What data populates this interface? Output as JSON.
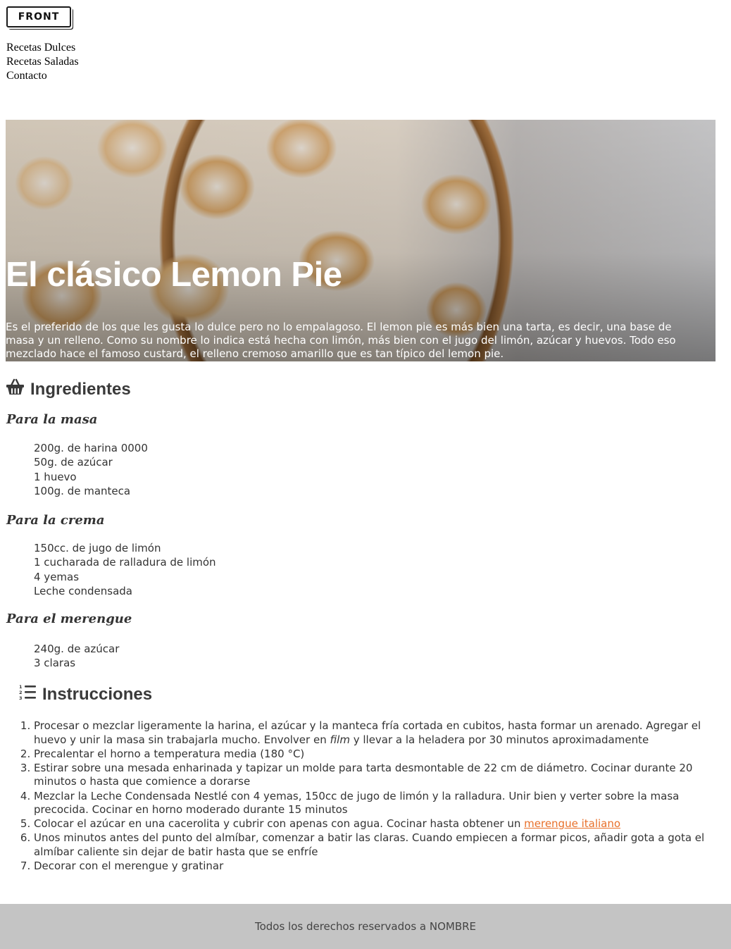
{
  "header": {
    "logo": "FRONT",
    "nav": [
      "Recetas Dulces",
      "Recetas Saladas",
      "Contacto"
    ]
  },
  "hero": {
    "title": "El clásico Lemon Pie",
    "description": "Es el preferido de los que les gusta lo dulce pero no lo empalagoso. El lemon pie es más bien una tarta, es decir, una base de masa y un relleno. Como su nombre lo indica está hecha con limón, más bien con el jugo del limón, azúcar y huevos. Todo eso mezclado hace el famoso custard, el relleno cremoso amarillo que es tan típico del lemon pie."
  },
  "ingredients": {
    "heading": "Ingredientes",
    "icon": "basket-icon",
    "groups": [
      {
        "title": "Para la masa",
        "items": [
          "200g. de harina 0000",
          "50g. de azúcar",
          "1 huevo",
          "100g. de manteca"
        ]
      },
      {
        "title": "Para la crema",
        "items": [
          "150cc. de jugo de limón",
          "1 cucharada de ralladura de limón",
          "4 yemas",
          "Leche condensada"
        ]
      },
      {
        "title": "Para el merengue",
        "items": [
          "240g. de azúcar",
          "3 claras"
        ]
      }
    ]
  },
  "instructions": {
    "heading": "Instrucciones",
    "icon": "numbered-list-icon",
    "steps": [
      {
        "before": "Procesar o mezclar ligeramente la harina, el azúcar y la manteca fría cortada en cubitos, hasta formar un arenado. Agregar el huevo y unir la masa sin trabajarla mucho. Envolver en ",
        "em": "film",
        "after": " y llevar a la heladera por 30 minutos aproximadamente"
      },
      {
        "text": "Precalentar el horno a temperatura media (180 °C)"
      },
      {
        "text": "Estirar sobre una mesada enharinada y tapizar un molde para tarta desmontable de 22 cm de diámetro. Cocinar durante 20 minutos o hasta que comience a dorarse"
      },
      {
        "text": "Mezclar la Leche Condensada Nestlé con 4 yemas, 150cc de jugo de limón y la ralladura. Unir bien y verter sobre la masa precocida. Cocinar en horno moderado durante 15 minutos"
      },
      {
        "before": "Colocar el azúcar en una cacerolita y cubrir con apenas con agua. Cocinar hasta obtener un ",
        "link": "merengue italiano"
      },
      {
        "text": "Unos minutos antes del punto del almíbar, comenzar a batir las claras. Cuando empiecen a formar picos, añadir gota a gota el almíbar caliente sin dejar de batir hasta que se enfríe"
      },
      {
        "text": "Decorar con el merengue y gratinar"
      }
    ]
  },
  "footer": {
    "text": "Todos los derechos reservados a NOMBRE"
  },
  "colors": {
    "link": "#e8702a",
    "footer_bg": "#c4c4c4",
    "text": "#333333"
  }
}
